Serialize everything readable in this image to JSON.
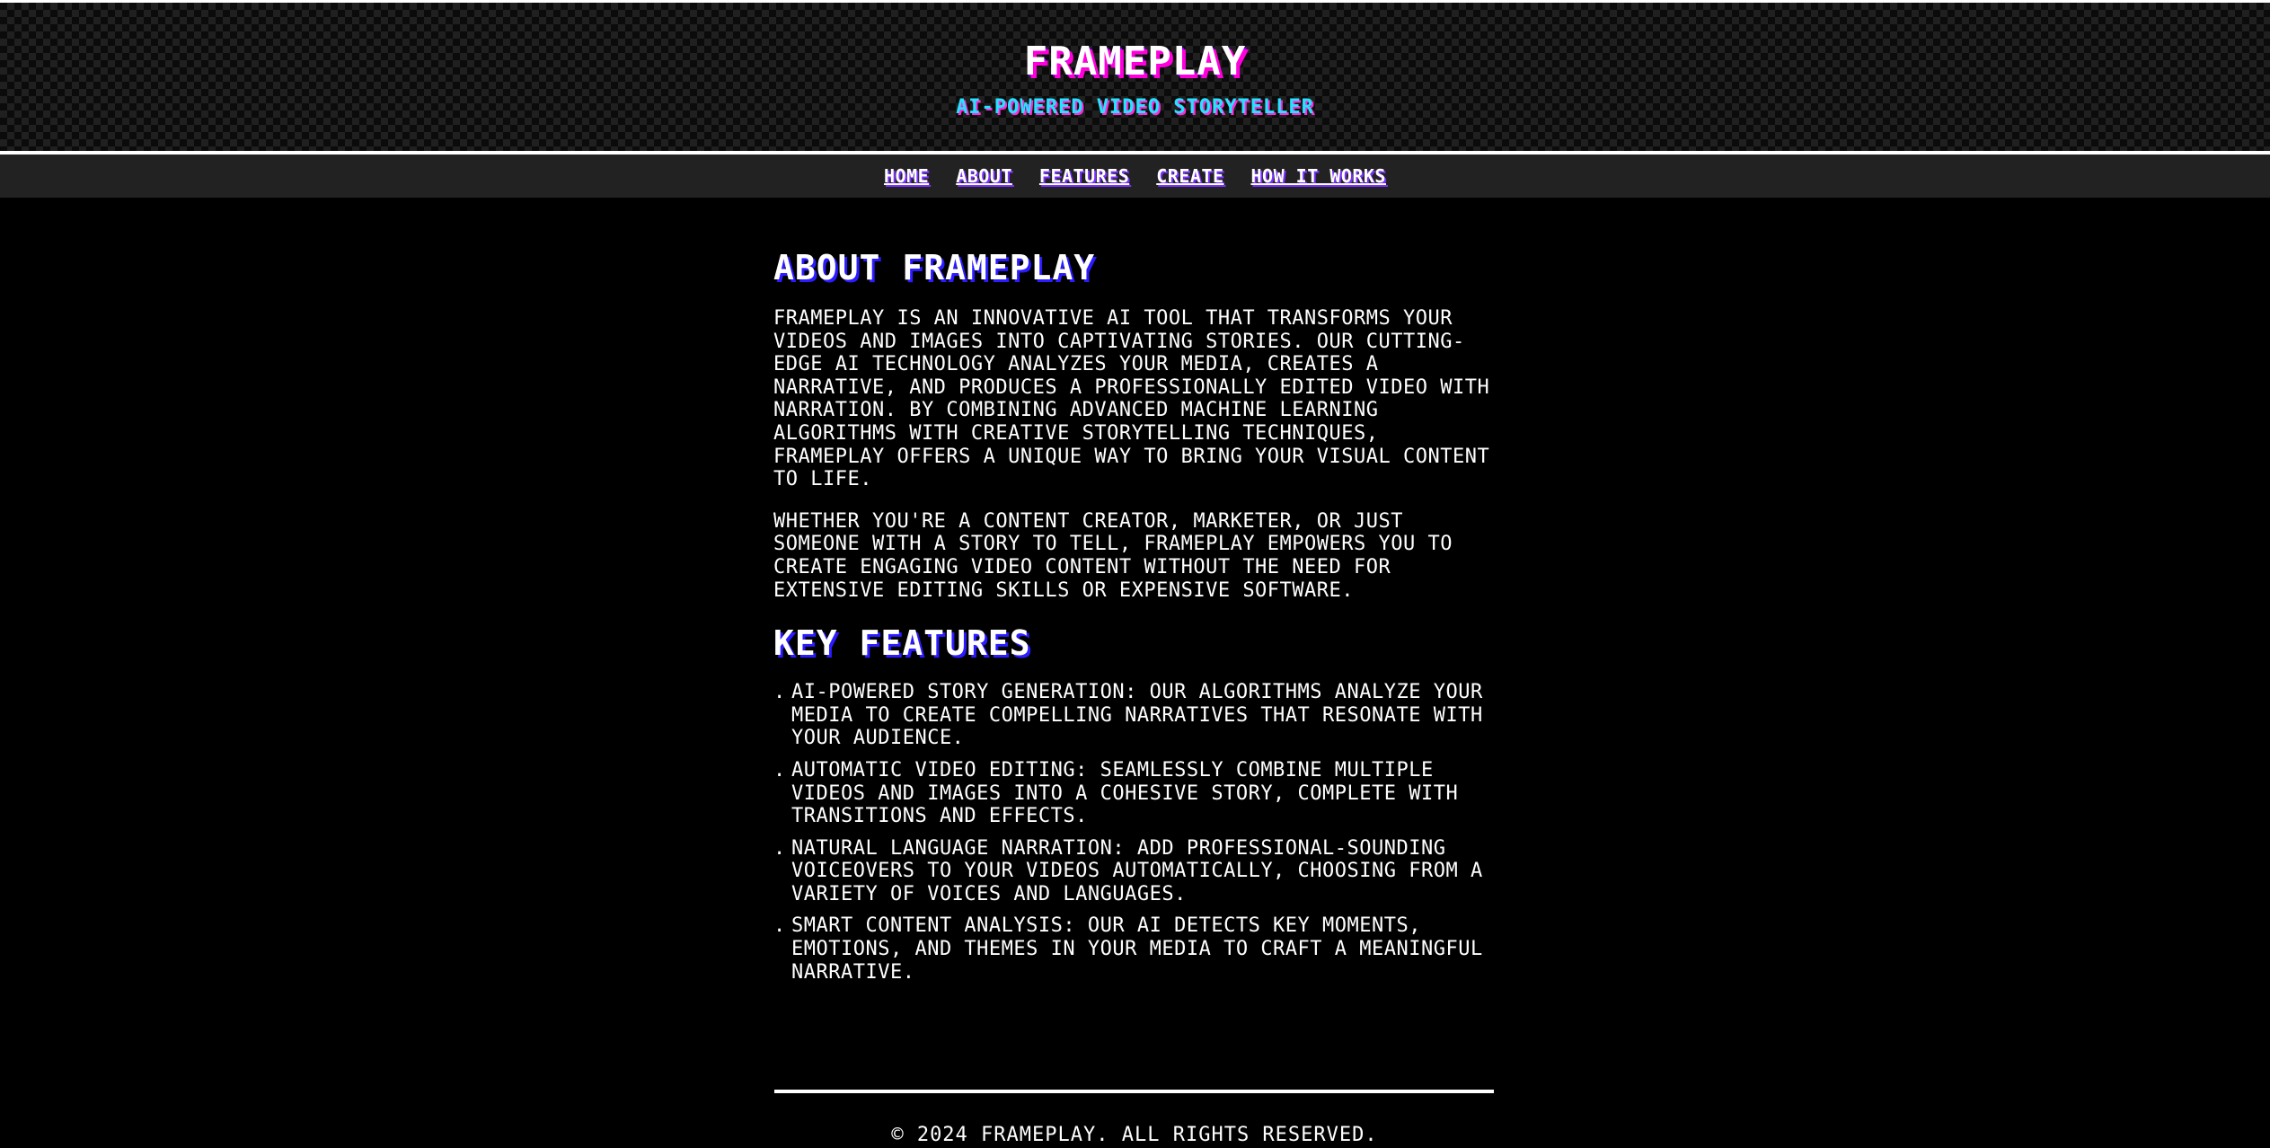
{
  "header": {
    "logo": "FRAMEPLAY",
    "tagline": "AI-POWERED VIDEO STORYTELLER"
  },
  "nav": {
    "items": [
      {
        "label": "HOME"
      },
      {
        "label": "ABOUT"
      },
      {
        "label": "FEATURES"
      },
      {
        "label": "CREATE"
      },
      {
        "label": "HOW IT WORKS"
      }
    ]
  },
  "about": {
    "heading": "ABOUT FRAMEPLAY",
    "paragraphs": [
      "FRAMEPLAY IS AN INNOVATIVE AI TOOL THAT TRANSFORMS YOUR VIDEOS AND IMAGES INTO CAPTIVATING STORIES. OUR CUTTING-EDGE AI TECHNOLOGY ANALYZES YOUR MEDIA, CREATES A NARRATIVE, AND PRODUCES A PROFESSIONALLY EDITED VIDEO WITH NARRATION. BY COMBINING ADVANCED MACHINE LEARNING ALGORITHMS WITH CREATIVE STORYTELLING TECHNIQUES, FRAMEPLAY OFFERS A UNIQUE WAY TO BRING YOUR VISUAL CONTENT TO LIFE.",
      "WHETHER YOU'RE A CONTENT CREATOR, MARKETER, OR JUST SOMEONE WITH A STORY TO TELL, FRAMEPLAY EMPOWERS YOU TO CREATE ENGAGING VIDEO CONTENT WITHOUT THE NEED FOR EXTENSIVE EDITING SKILLS OR EXPENSIVE SOFTWARE."
    ]
  },
  "features": {
    "heading": "KEY FEATURES",
    "bullet": ".",
    "items": [
      "AI-POWERED STORY GENERATION: OUR ALGORITHMS ANALYZE YOUR MEDIA TO CREATE COMPELLING NARRATIVES THAT RESONATE WITH YOUR AUDIENCE.",
      "AUTOMATIC VIDEO EDITING: SEAMLESSLY COMBINE MULTIPLE VIDEOS AND IMAGES INTO A COHESIVE STORY, COMPLETE WITH TRANSITIONS AND EFFECTS.",
      "NATURAL LANGUAGE NARRATION: ADD PROFESSIONAL-SOUNDING VOICEOVERS TO YOUR VIDEOS AUTOMATICALLY, CHOOSING FROM A VARIETY OF VOICES AND LANGUAGES.",
      "SMART CONTENT ANALYSIS: OUR AI DETECTS KEY MOMENTS, EMOTIONS, AND THEMES IN YOUR MEDIA TO CRAFT A MEANINGFUL NARRATIVE."
    ]
  },
  "footer": {
    "copyright": "© 2024 FRAMEPLAY. ALL RIGHTS RESERVED."
  },
  "colors": {
    "background": "#000000",
    "nav_background": "#222222",
    "accent_magenta": "#ff00dd",
    "accent_cyan": "#23e4ff",
    "accent_blue": "#2b1bff"
  }
}
